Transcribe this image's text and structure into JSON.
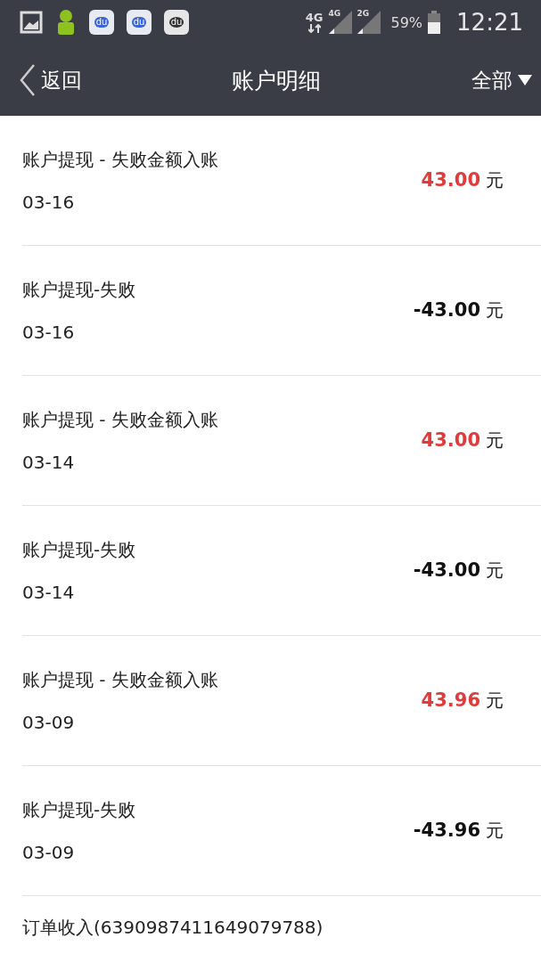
{
  "status_bar": {
    "notifications": [
      {
        "kind": "gallery"
      },
      {
        "kind": "robot"
      },
      {
        "kind": "paw",
        "label": "du"
      },
      {
        "kind": "paw",
        "label": "du"
      },
      {
        "kind": "pin",
        "label": "du"
      }
    ],
    "network": "4G",
    "sim1": "4G",
    "sim2": "2G",
    "battery": "59%",
    "time": "12:21"
  },
  "nav": {
    "back": "返回",
    "title": "账户明细",
    "filter": "全部"
  },
  "records": [
    {
      "title": "账户提现 - 失败金额入账",
      "date": "03-16",
      "amount": "43.00",
      "unit": "元",
      "kind": "credit"
    },
    {
      "title": "账户提现-失败",
      "date": "03-16",
      "amount": "-43.00",
      "unit": "元",
      "kind": "debit"
    },
    {
      "title": "账户提现 - 失败金额入账",
      "date": "03-14",
      "amount": "43.00",
      "unit": "元",
      "kind": "credit"
    },
    {
      "title": "账户提现-失败",
      "date": "03-14",
      "amount": "-43.00",
      "unit": "元",
      "kind": "debit"
    },
    {
      "title": "账户提现 - 失败金额入账",
      "date": "03-09",
      "amount": "43.96",
      "unit": "元",
      "kind": "credit"
    },
    {
      "title": "账户提现-失败",
      "date": "03-09",
      "amount": "-43.96",
      "unit": "元",
      "kind": "debit"
    },
    {
      "title": "订单收入(6390987411649079788)",
      "kind": "partial"
    }
  ]
}
